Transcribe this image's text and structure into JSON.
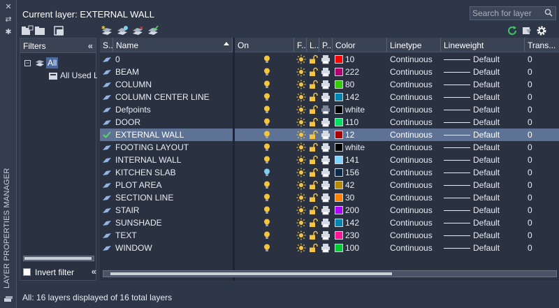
{
  "palette_title": "LAYER PROPERTIES MANAGER",
  "current_layer": "Current layer: EXTERNAL WALL",
  "search": {
    "placeholder": "Search for layer"
  },
  "filters": {
    "header": "Filters",
    "tree": [
      {
        "label": "All",
        "selected": true
      },
      {
        "label": "All Used La",
        "selected": false
      }
    ],
    "invert_filter_label": "Invert filter",
    "invert_filter_checked": false
  },
  "columns": [
    "S...",
    "Name",
    "On",
    "F...",
    "L...",
    "P...",
    "Color",
    "Linetype",
    "Lineweight",
    "Trans..."
  ],
  "layers": [
    {
      "name": "0",
      "color_num": "10",
      "color_hex": "#ff0000",
      "linetype": "Continuous",
      "lineweight": "Default",
      "transparency": "0",
      "on_color": "#f5c542",
      "current": false,
      "plot": true
    },
    {
      "name": "BEAM",
      "color_num": "222",
      "color_hex": "#b3006e",
      "linetype": "Continuous",
      "lineweight": "Default",
      "transparency": "0",
      "on_color": "#f5c542",
      "current": false,
      "plot": true
    },
    {
      "name": "COLUMN",
      "color_num": "80",
      "color_hex": "#33cc00",
      "linetype": "Continuous",
      "lineweight": "Default",
      "transparency": "0",
      "on_color": "#f5c542",
      "current": false,
      "plot": true
    },
    {
      "name": "COLUMN CENTER LINE",
      "color_num": "142",
      "color_hex": "#0084b0",
      "linetype": "Continuous",
      "lineweight": "Default",
      "transparency": "0",
      "on_color": "#f5c542",
      "current": false,
      "plot": true
    },
    {
      "name": "Defpoints",
      "color_num": "white",
      "color_hex": "#000000",
      "linetype": "Continuous",
      "lineweight": "Default",
      "transparency": "0",
      "on_color": "#f5c542",
      "current": false,
      "plot": false
    },
    {
      "name": "DOOR",
      "color_num": "110",
      "color_hex": "#00e060",
      "linetype": "Continuous",
      "lineweight": "Default",
      "transparency": "0",
      "on_color": "#f5c542",
      "current": false,
      "plot": true
    },
    {
      "name": "EXTERNAL WALL",
      "color_num": "12",
      "color_hex": "#a80000",
      "linetype": "Continuous",
      "lineweight": "Default",
      "transparency": "0",
      "on_color": "#f5c542",
      "current": true,
      "plot": true
    },
    {
      "name": "FOOTING LAYOUT",
      "color_num": "white",
      "color_hex": "#000000",
      "linetype": "Continuous",
      "lineweight": "Default",
      "transparency": "0",
      "on_color": "#f5c542",
      "current": false,
      "plot": true
    },
    {
      "name": "INTERNAL WALL",
      "color_num": "141",
      "color_hex": "#7fd4ff",
      "linetype": "Continuous",
      "lineweight": "Default",
      "transparency": "0",
      "on_color": "#f5c542",
      "current": false,
      "plot": true
    },
    {
      "name": "KITCHEN SLAB",
      "color_num": "156",
      "color_hex": "#0a2a4a",
      "linetype": "Continuous",
      "lineweight": "Default",
      "transparency": "0",
      "on_color": "#7fd0f0",
      "current": false,
      "plot": true
    },
    {
      "name": "PLOT AREA",
      "color_num": "42",
      "color_hex": "#b88a00",
      "linetype": "Continuous",
      "lineweight": "Default",
      "transparency": "0",
      "on_color": "#f5c542",
      "current": false,
      "plot": true
    },
    {
      "name": "SECTION LINE",
      "color_num": "30",
      "color_hex": "#ff7f00",
      "linetype": "Continuous",
      "lineweight": "Default",
      "transparency": "0",
      "on_color": "#f5c542",
      "current": false,
      "plot": true
    },
    {
      "name": "STAIR",
      "color_num": "200",
      "color_hex": "#b000ff",
      "linetype": "Continuous",
      "lineweight": "Default",
      "transparency": "0",
      "on_color": "#f5c542",
      "current": false,
      "plot": true
    },
    {
      "name": "SUNSHADE",
      "color_num": "142",
      "color_hex": "#0084b0",
      "linetype": "Continuous",
      "lineweight": "Default",
      "transparency": "0",
      "on_color": "#f5c542",
      "current": false,
      "plot": true
    },
    {
      "name": "TEXT",
      "color_num": "230",
      "color_hex": "#ff1493",
      "linetype": "Continuous",
      "lineweight": "Default",
      "transparency": "0",
      "on_color": "#f5c542",
      "current": false,
      "plot": true
    },
    {
      "name": "WINDOW",
      "color_num": "100",
      "color_hex": "#00cc33",
      "linetype": "Continuous",
      "lineweight": "Default",
      "transparency": "0",
      "on_color": "#f5c542",
      "current": false,
      "plot": true
    }
  ],
  "status_bar": "All: 16 layers displayed of 16 total layers",
  "colors": {
    "accent_selected": "#5d7294",
    "panel": "#2a3241",
    "header": "#3a4354"
  }
}
